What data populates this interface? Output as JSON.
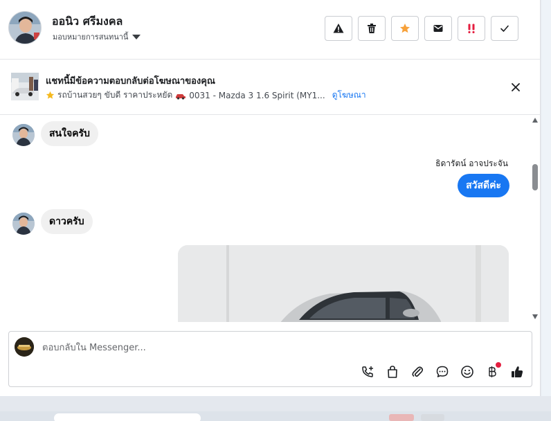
{
  "header": {
    "contact_name": "ออนิว ศรีมงคล",
    "assign_label": "มอบหมายการสนทนานี้",
    "action_icons": [
      "warning-icon",
      "trash-icon",
      "star-icon",
      "envelope-icon",
      "double-exclamation-icon",
      "check-icon"
    ]
  },
  "ad_banner": {
    "title": "แชทนี้มีข้อความตอบกลับต่อโฆษณาของคุณ",
    "ad_text": "รถบ้านสวยๆ ขับดี ราคาประหยัด",
    "car_text": "0031 - Mazda 3 1.6 Spirit (MY1...",
    "view_ad_link": "ดูโฆษณา"
  },
  "messages": {
    "in_1": "สนใจครับ",
    "out_sender": "ธิดารัตน์ อาจประจัน",
    "out_1": "สวัสดีค่ะ",
    "in_2": "ดาวครับ"
  },
  "composer": {
    "placeholder": "ตอบกลับใน Messenger...",
    "tools": [
      "call-add-icon",
      "shopping-bag-icon",
      "paperclip-icon",
      "chat-bubble-icon",
      "emoji-icon",
      "baht-icon",
      "thumbs-up-icon"
    ]
  },
  "colors": {
    "accent": "#1877f2",
    "star": "#f7a13a",
    "alert_red": "#e41e3f"
  }
}
